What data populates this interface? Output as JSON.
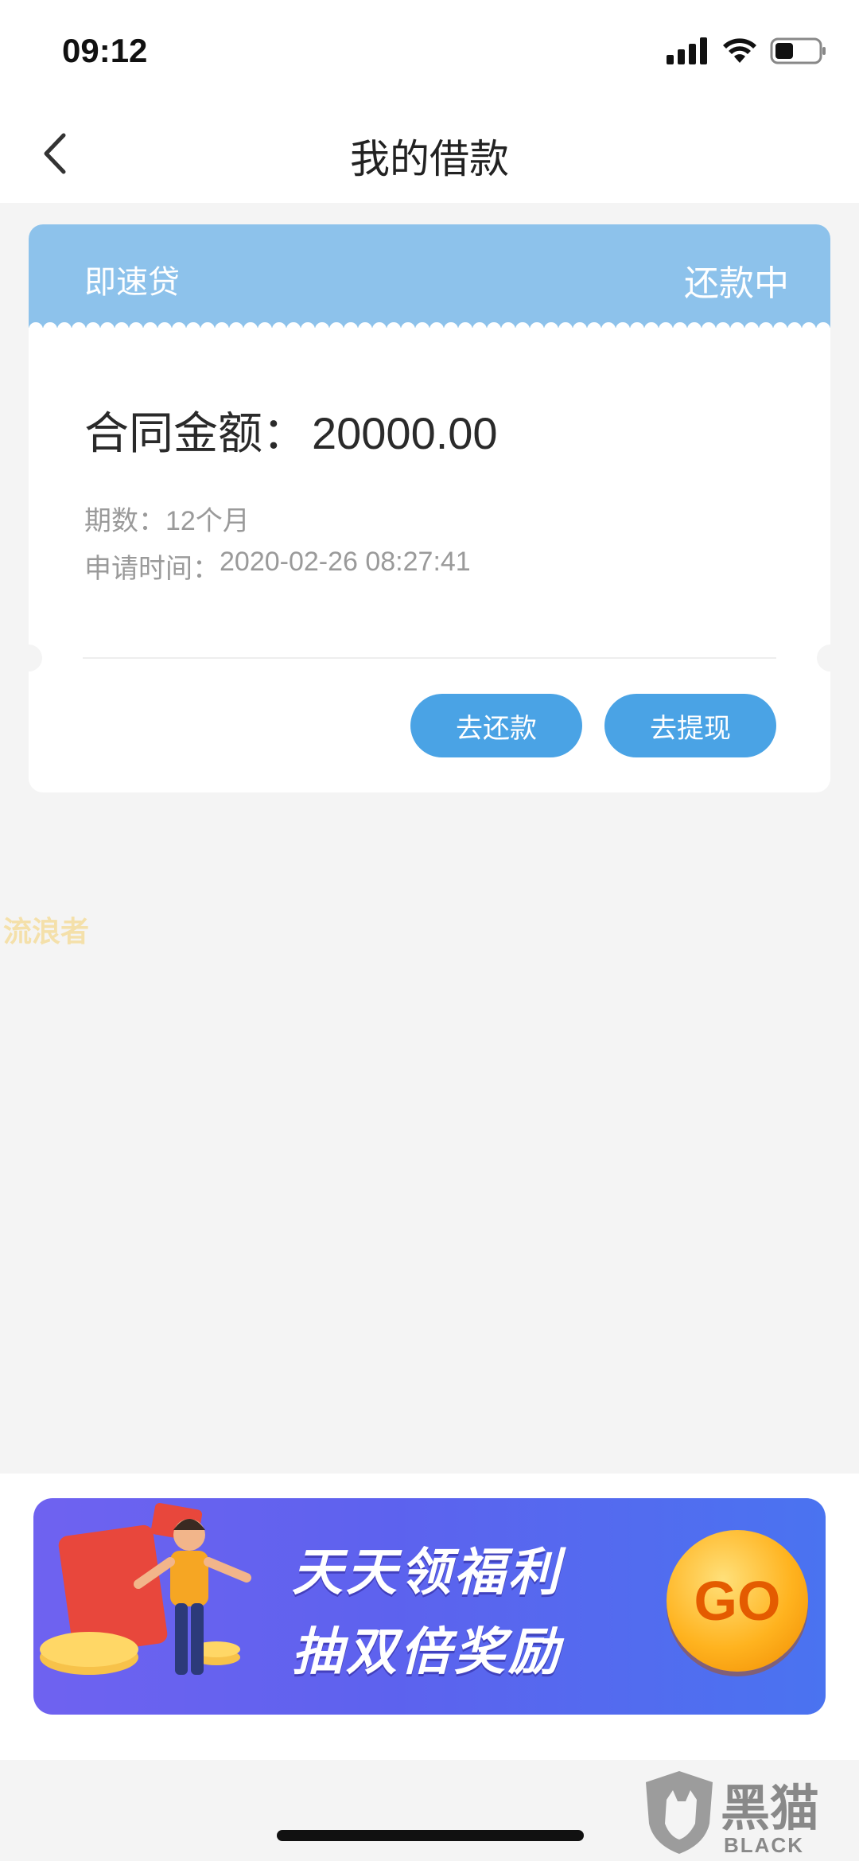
{
  "status_bar": {
    "time": "09:12"
  },
  "nav": {
    "title": "我的借款",
    "back_icon": "chevron-left-icon"
  },
  "loan_card": {
    "product_name": "即速贷",
    "status": "还款中",
    "contract_amount_label": "合同金额：",
    "contract_amount_value": "20000.00",
    "term_label": "期数：",
    "term_value": "12个月",
    "apply_time_label": "申请时间：",
    "apply_time_value": "2020-02-26 08:27:41",
    "repay_button": "去还款",
    "withdraw_button": "去提现"
  },
  "overlay_text": "流浪者",
  "banner": {
    "line1": "天天领福利",
    "line2": "抽双倍奖励",
    "go_label": "GO"
  },
  "brand_watermark": {
    "name": "黑猫",
    "english": "BLACK CAT"
  },
  "colors": {
    "header_blue": "#8dc2eb",
    "button_blue": "#4aa3e5",
    "background": "#f4f4f4"
  }
}
